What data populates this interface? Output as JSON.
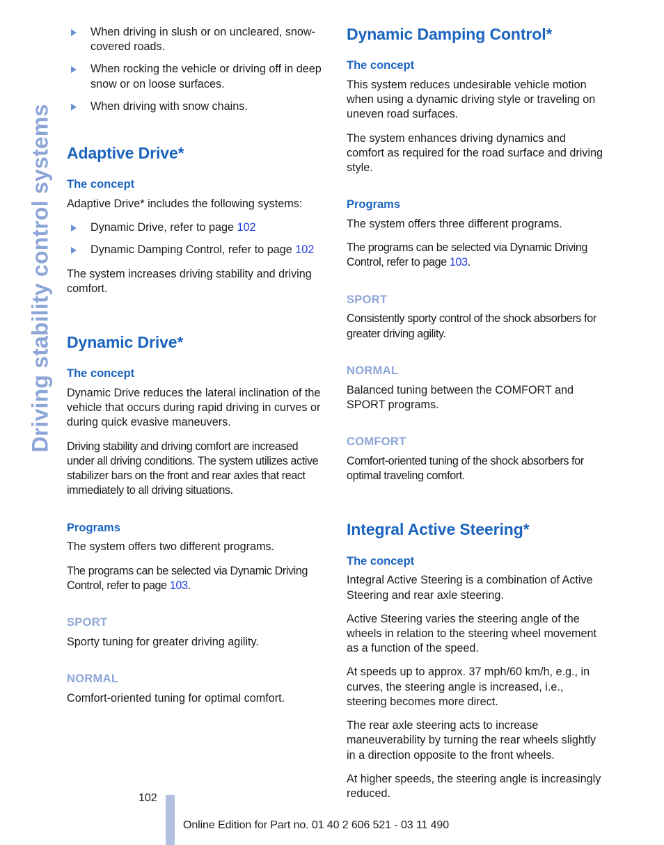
{
  "chapter": {
    "title": "Driving stability control systems"
  },
  "left_column": {
    "intro_bullets": [
      "When driving in slush or on uncleared, snow-covered roads.",
      "When rocking the vehicle or driving off in deep snow or on loose surfaces.",
      "When driving with snow chains."
    ],
    "sections": [
      {
        "heading": "Adaptive Drive*",
        "subheading_concept": "The concept",
        "concept_intro": "Adaptive Drive* includes the following systems:",
        "concept_bullets": [
          {
            "text_before": "Dynamic Drive, refer to page ",
            "page": "102",
            "text_after": ""
          },
          {
            "text_before": "Dynamic Damping Control, refer to page ",
            "page": "102",
            "text_after": ""
          }
        ],
        "concept_closing": "The system increases driving stability and driving comfort."
      },
      {
        "heading": "Dynamic Drive*",
        "subheading_concept": "The concept",
        "concept_p1": "Dynamic Drive reduces the lateral inclination of the vehicle that occurs during rapid driving in curves or during quick evasive maneuvers.",
        "concept_p2": "Driving stability and driving comfort are increased under all driving conditions. The system utilizes active stabilizer bars on the front and rear axles that react immediately to all driving situations.",
        "subheading_programs": "Programs",
        "programs_p1": "The system offers two different programs.",
        "programs_p2_before": "The programs can be selected via Dynamic Driving Control, refer to page ",
        "programs_p2_page": "103",
        "programs_p2_after": ".",
        "mode_sport_label": "SPORT",
        "mode_sport_text": "Sporty tuning for greater driving agility.",
        "mode_normal_label": "NORMAL",
        "mode_normal_text": "Comfort-oriented tuning for optimal comfort."
      }
    ]
  },
  "right_column": {
    "sections": [
      {
        "heading": "Dynamic Damping Control*",
        "subheading_concept": "The concept",
        "concept_p1": "This system reduces undesirable vehicle motion when using a dynamic driving style or traveling on uneven road surfaces.",
        "concept_p2": "The system enhances driving dynamics and comfort as required for the road surface and driving style.",
        "subheading_programs": "Programs",
        "programs_p1": "The system offers three different programs.",
        "programs_p2_before": "The programs can be selected via Dynamic Driving Control, refer to page ",
        "programs_p2_page": "103",
        "programs_p2_after": ".",
        "mode_sport_label": "SPORT",
        "mode_sport_text": "Consistently sporty control of the shock absorbers for greater driving agility.",
        "mode_normal_label": "NORMAL",
        "mode_normal_text": "Balanced tuning between the COMFORT and SPORT programs.",
        "mode_comfort_label": "COMFORT",
        "mode_comfort_text": "Comfort-oriented tuning of the shock absorbers for optimal traveling comfort."
      },
      {
        "heading": "Integral Active Steering*",
        "subheading_concept": "The concept",
        "concept_p1": "Integral Active Steering is a combination of Active Steering and rear axle steering.",
        "concept_p2": "Active Steering varies the steering angle of the wheels in relation to the steering wheel movement as a function of the speed.",
        "concept_p3": "At speeds up to approx. 37 mph/60 km/h, e.g., in curves, the steering angle is increased, i.e., steering becomes more direct.",
        "concept_p4": "The rear axle steering acts to increase maneuverability by turning the rear wheels slightly in a direction opposite to the front wheels.",
        "concept_p5": "At higher speeds, the steering angle is increasingly reduced."
      }
    ]
  },
  "footer": {
    "page_number": "102",
    "note": "Online Edition for Part no. 01 40 2 606 521 - 03 11 490"
  },
  "colors": {
    "heading_blue": "#1a64be",
    "accent_light_blue": "#8da6d8",
    "link_blue": "#1f3ee0",
    "footer_bar": "#b2c1e2",
    "body_text": "#1b1b1b"
  }
}
